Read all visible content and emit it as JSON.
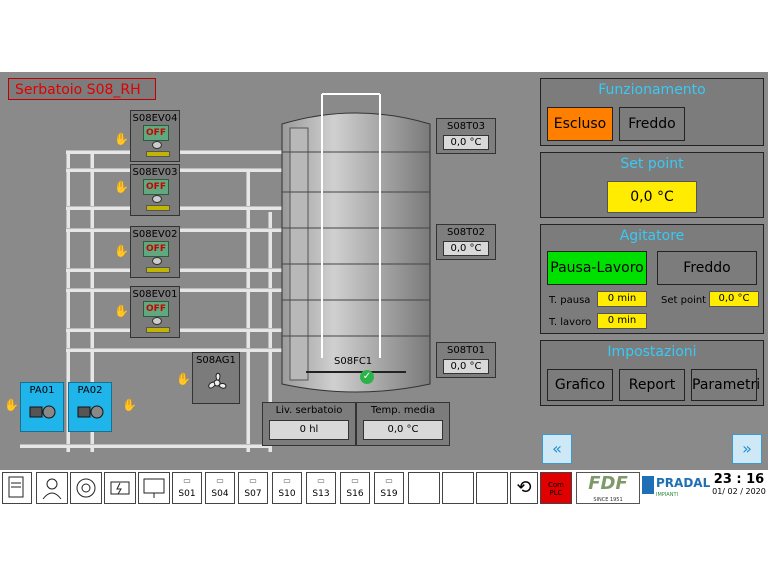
{
  "title": "Serbatoio S08_RH",
  "valves": [
    {
      "label": "S08EV04",
      "state": "OFF"
    },
    {
      "label": "S08EV03",
      "state": "OFF"
    },
    {
      "label": "S08EV02",
      "state": "OFF"
    },
    {
      "label": "S08EV01",
      "state": "OFF"
    }
  ],
  "agitator_unit": {
    "label": "S08AG1"
  },
  "pumps": [
    {
      "label": "PA01"
    },
    {
      "label": "PA02"
    }
  ],
  "sensors": [
    {
      "label": "S08T03",
      "value": "0,0 °C"
    },
    {
      "label": "S08T02",
      "value": "0,0 °C"
    },
    {
      "label": "S08T01",
      "value": "0,0 °C"
    }
  ],
  "flow": {
    "label": "S08FC1"
  },
  "level": {
    "label": "Liv. serbatoio",
    "value": "0 hl"
  },
  "temp_media": {
    "label": "Temp. media",
    "value": "0,0 °C"
  },
  "funzionamento": {
    "title": "Funzionamento",
    "btn_escluso": "Escluso",
    "btn_freddo": "Freddo"
  },
  "setpoint": {
    "title": "Set point",
    "value": "0,0 °C"
  },
  "agitatore": {
    "title": "Agitatore",
    "btn_pausa": "Pausa-Lavoro",
    "btn_freddo": "Freddo",
    "t_pausa_label": "T. pausa",
    "t_pausa": "0 min",
    "t_lavoro_label": "T. lavoro",
    "t_lavoro": "0 min",
    "sp_label": "Set point",
    "sp_value": "0,0 °C"
  },
  "impostazioni": {
    "title": "Impostazioni",
    "grafico": "Grafico",
    "report": "Report",
    "parametri": "Parametri"
  },
  "nav": {
    "prev": "«",
    "next": "»"
  },
  "bottom_tabs": [
    "S01",
    "S04",
    "S07",
    "S10",
    "S13",
    "S16",
    "S19"
  ],
  "status": {
    "plc": "Com PLC"
  },
  "logos": {
    "fdf": "FDF",
    "fdf_sub": "SINCE 1951",
    "pradal": "PRADAL",
    "pradal_sub": "IMPIANTI"
  },
  "clock": {
    "time": "23 : 16",
    "date": "01/ 02 / 2020"
  },
  "colors": {
    "background": "#8a8a8a",
    "accent_cyan": "#39c9f5",
    "orange": "#ff7f00",
    "green": "#00e000",
    "yellow": "#ffec00",
    "pump_blue": "#1fb5ea"
  }
}
